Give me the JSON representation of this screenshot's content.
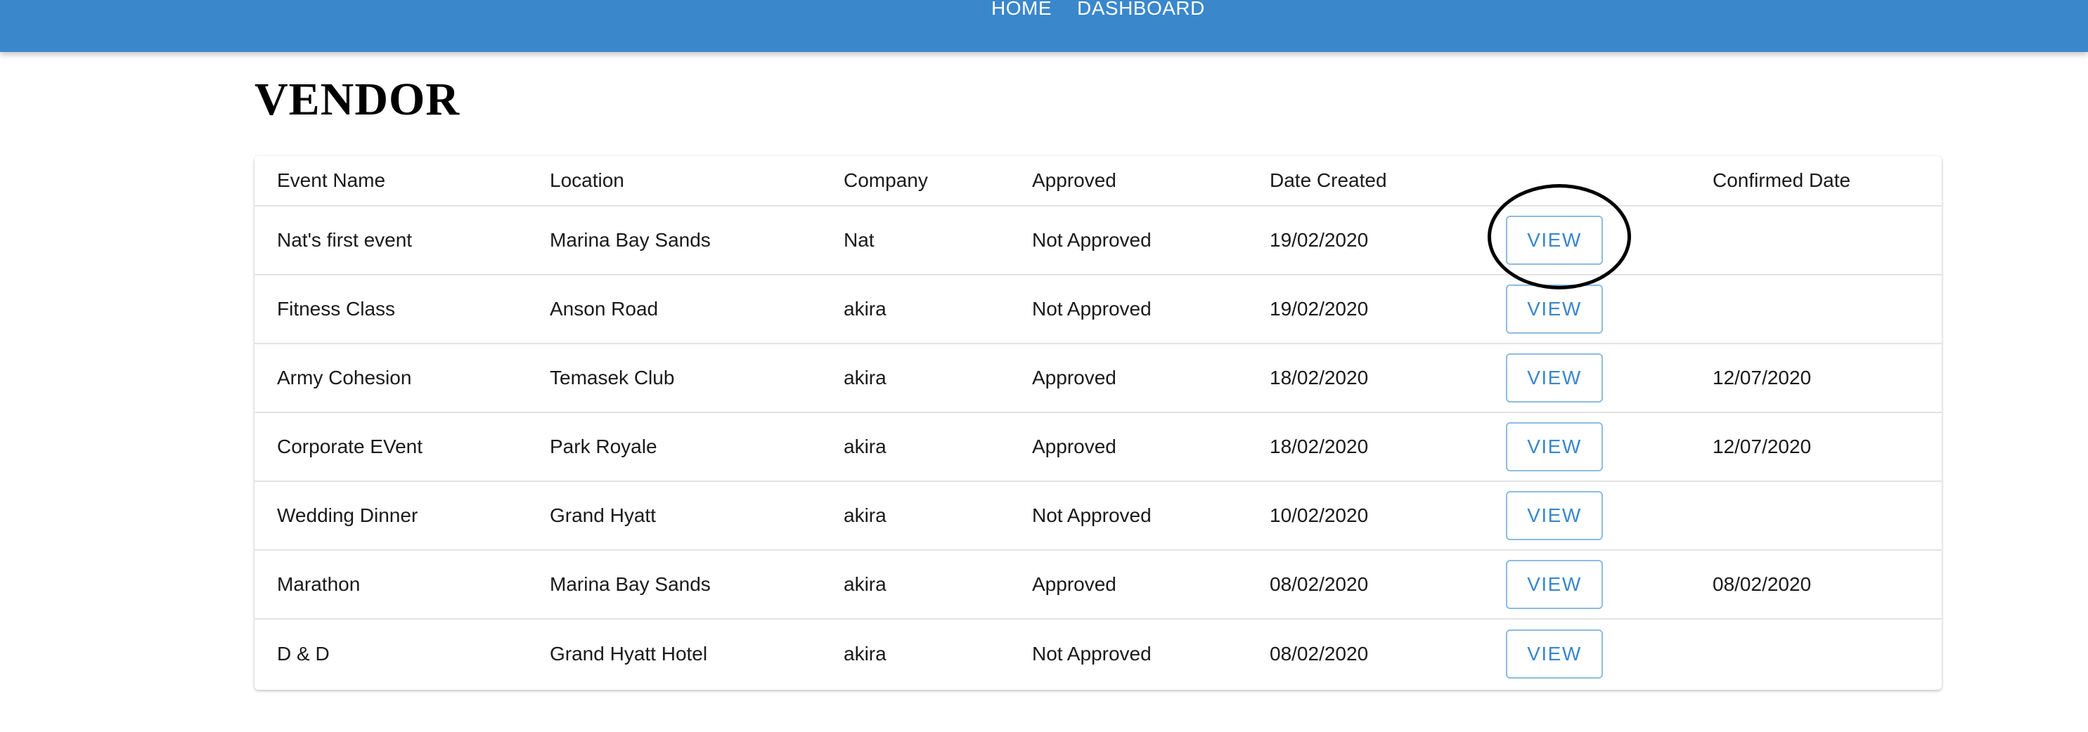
{
  "nav": {
    "home_label": "HOME",
    "dashboard_label": "DASHBOARD"
  },
  "page": {
    "title": "VENDOR"
  },
  "table": {
    "headers": [
      "Event Name",
      "Location",
      "Company",
      "Approved",
      "Date Created",
      "",
      "Confirmed Date"
    ],
    "view_label": "VIEW",
    "rows": [
      {
        "event_name": "Nat's first event",
        "location": "Marina Bay Sands",
        "company": "Nat",
        "approved": "Not Approved",
        "date_created": "19/02/2020",
        "confirmed_date": ""
      },
      {
        "event_name": "Fitness Class",
        "location": "Anson Road",
        "company": "akira",
        "approved": "Not Approved",
        "date_created": "19/02/2020",
        "confirmed_date": ""
      },
      {
        "event_name": "Army Cohesion",
        "location": "Temasek Club",
        "company": "akira",
        "approved": "Approved",
        "date_created": "18/02/2020",
        "confirmed_date": "12/07/2020"
      },
      {
        "event_name": "Corporate EVent",
        "location": "Park Royale",
        "company": "akira",
        "approved": "Approved",
        "date_created": "18/02/2020",
        "confirmed_date": "12/07/2020"
      },
      {
        "event_name": "Wedding Dinner",
        "location": "Grand Hyatt",
        "company": "akira",
        "approved": "Not Approved",
        "date_created": "10/02/2020",
        "confirmed_date": ""
      },
      {
        "event_name": "Marathon",
        "location": "Marina Bay Sands",
        "company": "akira",
        "approved": "Approved",
        "date_created": "08/02/2020",
        "confirmed_date": "08/02/2020"
      },
      {
        "event_name": "D & D",
        "location": "Grand Hyatt Hotel",
        "company": "akira",
        "approved": "Not Approved",
        "date_created": "08/02/2020",
        "confirmed_date": ""
      }
    ]
  },
  "colors": {
    "topbar": "#3a87cb",
    "button_text": "#3a87cb",
    "button_border": "#8ebbe3",
    "row_divider": "#e3e3e3",
    "annotation": "#000000"
  }
}
